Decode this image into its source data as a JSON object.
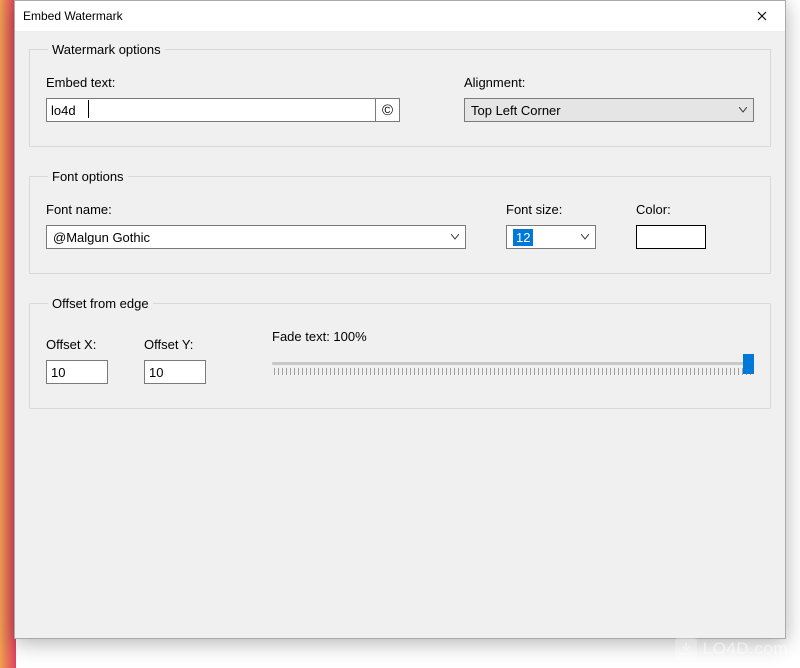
{
  "window": {
    "title": "Embed Watermark"
  },
  "watermark_options": {
    "legend": "Watermark options",
    "embed_text_label": "Embed text:",
    "embed_text_value": "lo4d",
    "copyright_symbol": "©",
    "alignment_label": "Alignment:",
    "alignment_value": "Top Left Corner"
  },
  "font_options": {
    "legend": "Font options",
    "font_name_label": "Font name:",
    "font_name_value": "@Malgun Gothic",
    "font_size_label": "Font size:",
    "font_size_value": "12",
    "color_label": "Color:",
    "color_value": "#ffffff"
  },
  "offset": {
    "legend": "Offset from edge",
    "offset_x_label": "Offset X:",
    "offset_x_value": "10",
    "offset_y_label": "Offset Y:",
    "offset_y_value": "10",
    "fade_label": "Fade text: 100%",
    "fade_value": 100
  },
  "site_watermark": "LO4D.com"
}
